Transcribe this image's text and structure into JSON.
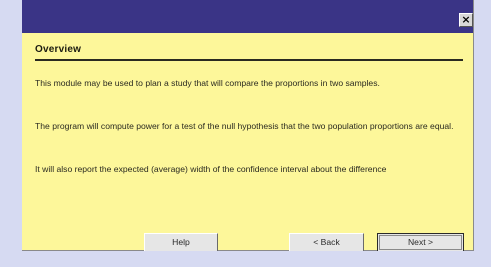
{
  "window": {
    "close_glyph": "×"
  },
  "overview": {
    "heading": "Overview",
    "paragraphs": [
      "This module may be used to plan a study that will compare the proportions in two samples.",
      "The program will compute power for a test of the null hypothesis that the two population proportions are equal.",
      "It will also report the expected (average) width of the confidence interval about the difference"
    ]
  },
  "buttons": {
    "help": "Help",
    "back": "< Back",
    "next": "Next >"
  },
  "colors": {
    "titlebar": "#3a3486",
    "panel": "#fdf79a",
    "background": "#d6daf2"
  }
}
